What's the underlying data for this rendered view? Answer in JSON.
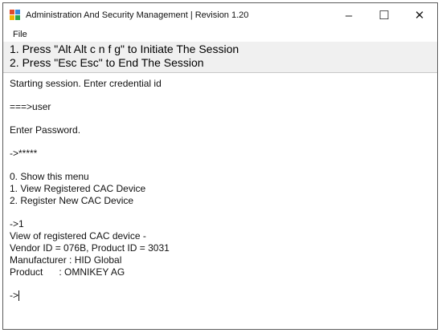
{
  "window": {
    "title": "Administration And Security Management  |  Revision 1.20",
    "controls": {
      "minimize": "–",
      "maximize": "☐",
      "close": "✕"
    }
  },
  "menu": {
    "items": [
      "File"
    ]
  },
  "banner": {
    "line1": "1. Press \"Alt Alt c n f g\" to Initiate The Session",
    "line2": "2. Press \"Esc Esc\" to End The Session"
  },
  "console": {
    "start": "Starting session. Enter credential id",
    "user_prompt": "===>user",
    "enter_password": "Enter Password.",
    "password_prompt": "->*****",
    "menu_0": "0. Show this menu",
    "menu_1": "1. View Registered CAC Device",
    "menu_2": "2. Register New CAC Device",
    "choice": "->1",
    "view_header": "View of registered CAC device -",
    "vendor_product": "Vendor ID = 076B, Product ID = 3031",
    "manufacturer": "Manufacturer : HID Global",
    "product": "Product      : OMNIKEY AG",
    "final_prompt": "->"
  }
}
